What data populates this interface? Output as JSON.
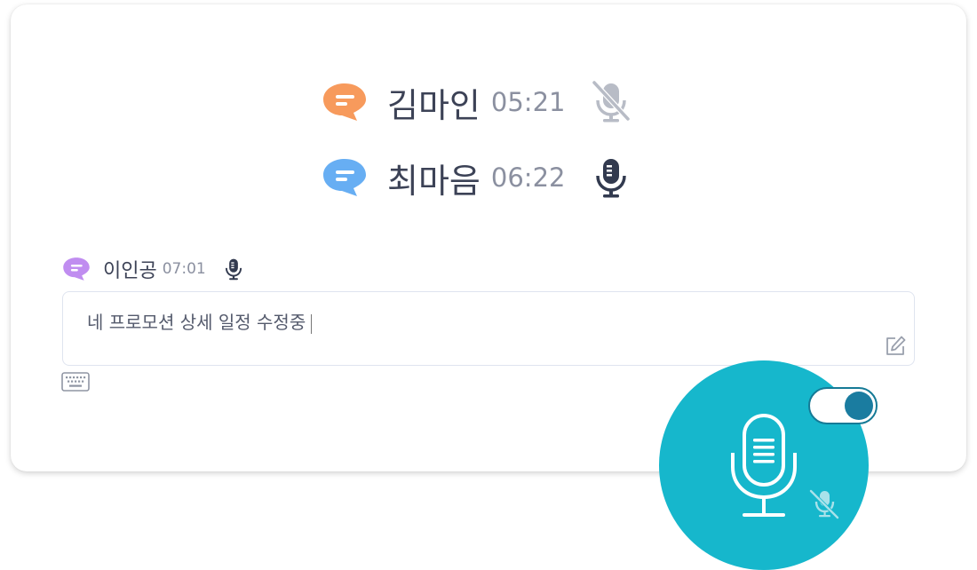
{
  "speakers": [
    {
      "name": "김마인",
      "time": "05:21",
      "mic": "mic-muted-icon",
      "bubble_color": "#f79a5c"
    },
    {
      "name": "최마음",
      "time": "06:22",
      "mic": "mic-active-icon",
      "bubble_color": "#67aef3"
    }
  ],
  "current": {
    "name": "이인공",
    "time": "07:01",
    "bubble_color": "#c08df0",
    "mic": "mic-active-icon",
    "transcript": "네 프로모션 상세 일정 수정중"
  },
  "icons": {
    "edit": "edit-icon",
    "keyboard": "keyboard-icon",
    "record": "microphone-icon",
    "mute": "mic-muted-icon"
  },
  "toggle": {
    "on": true
  },
  "colors": {
    "accent": "#16b7cc",
    "toggle": "#1a7ca0",
    "text": "#3c4256",
    "muted_text": "#8b90a0"
  }
}
